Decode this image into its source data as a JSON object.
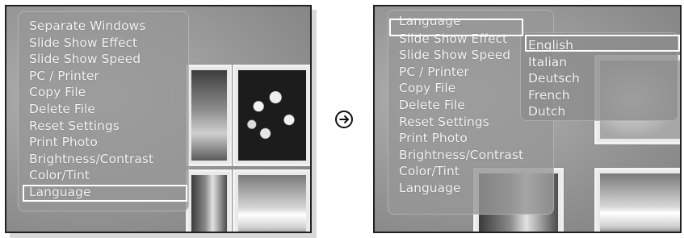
{
  "left_screen": {
    "menu_items": [
      {
        "label": "Separate Windows"
      },
      {
        "label": "Slide Show Effect"
      },
      {
        "label": "Slide Show Speed"
      },
      {
        "label": "PC / Printer"
      },
      {
        "label": "Copy File"
      },
      {
        "label": "Delete File"
      },
      {
        "label": "Reset Settings"
      },
      {
        "label": "Print Photo"
      },
      {
        "label": "Brightness/Contrast"
      },
      {
        "label": "Color/Tint"
      },
      {
        "label": "Language"
      }
    ],
    "selected_item": "Language"
  },
  "transition": {
    "icon": "circled-right-arrow-icon"
  },
  "right_screen": {
    "header_label": "Language",
    "menu_items": [
      {
        "label": "Slide Show Effect"
      },
      {
        "label": "Slide Show Speed"
      },
      {
        "label": "PC / Printer"
      },
      {
        "label": "Copy File"
      },
      {
        "label": "Delete File"
      },
      {
        "label": "Reset Settings"
      },
      {
        "label": "Print Photo"
      },
      {
        "label": "Brightness/Contrast"
      },
      {
        "label": "Color/Tint"
      },
      {
        "label": "Language"
      }
    ],
    "language_options": [
      {
        "label": "English"
      },
      {
        "label": "Italian"
      },
      {
        "label": "Deutsch"
      },
      {
        "label": "French"
      },
      {
        "label": "Dutch"
      }
    ],
    "selected_option": "English"
  },
  "colors": {
    "highlight": "#ffffff",
    "menu_text": "#f6f6f6",
    "frame": "#222222"
  }
}
